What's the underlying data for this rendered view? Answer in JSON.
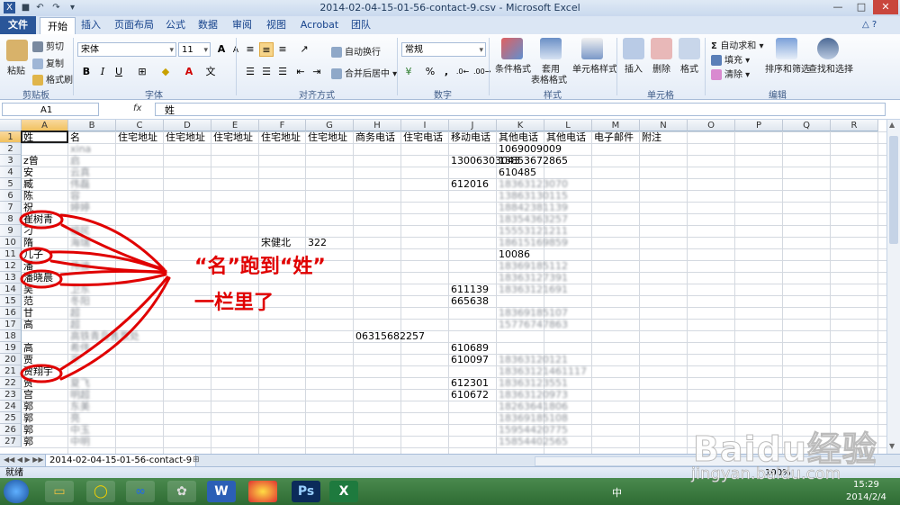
{
  "window": {
    "title": "2014-02-04-15-01-56-contact-9.csv  -  Microsoft Excel",
    "controls": [
      "—",
      "□",
      "✕"
    ]
  },
  "ribbon_tabs": [
    "文件",
    "开始",
    "插入",
    "页面布局",
    "公式",
    "数据",
    "审阅",
    "视图",
    "Acrobat",
    "团队"
  ],
  "ribbon": {
    "clipboard": {
      "paste": "粘贴",
      "cut": "剪切",
      "copy": "复制",
      "format_painter": "格式刷",
      "label": "剪贴板"
    },
    "font": {
      "name": "宋体",
      "size": "11",
      "bold": "B",
      "italic": "I",
      "underline": "U",
      "grow": "A",
      "shrink": "A",
      "label": "字体"
    },
    "alignment": {
      "wrap": "自动换行",
      "merge": "合并后居中",
      "label": "对齐方式"
    },
    "number": {
      "format": "常规",
      "percent": "%",
      "comma": ",",
      "label": "数字"
    },
    "styles": {
      "conditional": "条件格式",
      "table1": "套用",
      "table2": "表格格式",
      "cell_styles": "单元格样式",
      "label": "样式"
    },
    "cells": {
      "insert": "插入",
      "delete": "删除",
      "format": "格式",
      "label": "单元格"
    },
    "editing": {
      "autosum": "自动求和",
      "fill": "填充",
      "clear": "清除",
      "sort": "排序和筛选",
      "find": "查找和选择",
      "label": "编辑"
    }
  },
  "formula_bar": {
    "name_box": "A1",
    "fx": "fx",
    "content": "姓"
  },
  "columns": [
    "A",
    "B",
    "C",
    "D",
    "E",
    "F",
    "G",
    "H",
    "I",
    "J",
    "K",
    "L",
    "M",
    "N",
    "O",
    "P",
    "Q",
    "R"
  ],
  "header_row": [
    "姓",
    "名",
    "住宅地址",
    "住宅地址",
    "住宅地址",
    "住宅地址",
    "住宅地址",
    "商务电话",
    "住宅电话",
    "移动电话",
    "其他电话",
    "其他电话",
    "电子邮件",
    "附注"
  ],
  "rows": [
    {
      "n": "1"
    },
    {
      "n": "2",
      "b": "xina",
      "k": "1069009009"
    },
    {
      "n": "3",
      "a": "z曾",
      "b": "启",
      "j": "13006303043",
      "k": "13853672865"
    },
    {
      "n": "4",
      "a": "安",
      "b": "云真",
      "k": "610485"
    },
    {
      "n": "5",
      "a": "臧",
      "b": "伟磊",
      "j": "612016",
      "k": "18363123070"
    },
    {
      "n": "6",
      "a": "陈",
      "b": "容",
      "k": "13863130115"
    },
    {
      "n": "7",
      "a": "祝",
      "b": "婷婷",
      "k": "18842381139"
    },
    {
      "n": "8",
      "a": "崔树青",
      "k": "18354363257"
    },
    {
      "n": "9",
      "a": "刁",
      "b": "福民",
      "k": "15553121211"
    },
    {
      "n": "10",
      "a": "隋",
      "b": "海瑞",
      "f": "宋健北",
      "g": "322",
      "k": "18615169859"
    },
    {
      "n": "11",
      "a": "儿子",
      "k": "10086"
    },
    {
      "n": "12",
      "a": "潘",
      "b": "伟波",
      "k": "18369185112"
    },
    {
      "n": "13",
      "a": "潘晓晨",
      "k": "18363127391"
    },
    {
      "n": "14",
      "a": "吴",
      "b": "卫东",
      "j": "611139",
      "k": "18363121691"
    },
    {
      "n": "15",
      "a": "范",
      "b": "冬阳",
      "j": "665638"
    },
    {
      "n": "16",
      "a": "甘",
      "b": "超",
      "k": "18369185107"
    },
    {
      "n": "17",
      "a": "高",
      "b": "超",
      "k": "15776747863"
    },
    {
      "n": "18",
      "b": "高铁青岛售票处",
      "h": "06315682257"
    },
    {
      "n": "19",
      "a": "高",
      "b": "希伟",
      "j": "610689"
    },
    {
      "n": "20",
      "a": "贾",
      "b": "平",
      "j": "610097",
      "k": "18363120121"
    },
    {
      "n": "21",
      "a": "贾翔宇",
      "k": "18363121461117"
    },
    {
      "n": "22",
      "a": "贾",
      "b": "夏飞",
      "j": "612301",
      "k": "18363123551"
    },
    {
      "n": "23",
      "a": "宫",
      "b": "明超",
      "j": "610672",
      "k": "18363120973"
    },
    {
      "n": "24",
      "a": "郭",
      "b": "东美",
      "k": "18263641806"
    },
    {
      "n": "25",
      "a": "郭",
      "b": "亮",
      "k": "18369185108"
    },
    {
      "n": "26",
      "a": "郭",
      "b": "中玉",
      "k": "15954420775"
    },
    {
      "n": "27",
      "a": "郭",
      "b": "中明",
      "k": "15854402565"
    }
  ],
  "annotation": {
    "line1": "“名”跑到“姓”",
    "line2": "一栏里了",
    "color": "#e00000"
  },
  "sheet_tab": "2014-02-04-15-01-56-contact-9",
  "status": {
    "ready": "就绪",
    "zoom": "100%"
  },
  "taskbar": {
    "time": "15:29",
    "date": "2014/2/4",
    "ime": "中"
  },
  "watermark": {
    "brand": "Baidu经验",
    "url": "jingyan.baidu.com"
  }
}
